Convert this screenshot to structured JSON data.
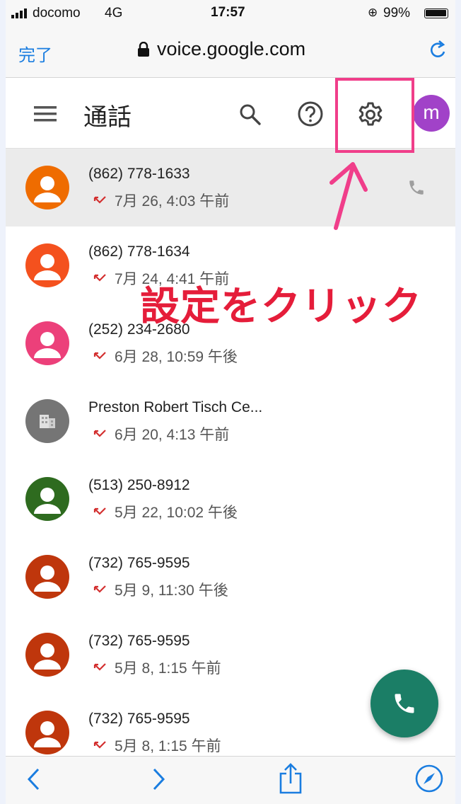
{
  "status_bar": {
    "carrier": "docomo",
    "network": "4G",
    "time": "17:57",
    "battery": "99%"
  },
  "browser": {
    "done_label": "完了",
    "url": "voice.google.com"
  },
  "app_header": {
    "title": "通話",
    "avatar_letter": "m"
  },
  "calls": [
    {
      "name": "(862) 778-1633",
      "time": "7月 26, 4:03 午前",
      "avatar_color": "#ef6c00",
      "avatar_type": "person",
      "selected": true
    },
    {
      "name": "(862) 778-1634",
      "time": "7月 24, 4:41 午前",
      "avatar_color": "#f4511e",
      "avatar_type": "person",
      "selected": false
    },
    {
      "name": "(252) 234-2680",
      "time": "6月 28, 10:59 午後",
      "avatar_color": "#ec407a",
      "avatar_type": "person",
      "selected": false
    },
    {
      "name": "Preston Robert Tisch Ce...",
      "time": "6月 20, 4:13 午前",
      "avatar_color": "#757575",
      "avatar_type": "business",
      "selected": false
    },
    {
      "name": "(513) 250-8912",
      "time": "5月 22, 10:02 午後",
      "avatar_color": "#2e6b1f",
      "avatar_type": "person",
      "selected": false
    },
    {
      "name": "(732) 765-9595",
      "time": "5月 9, 11:30 午後",
      "avatar_color": "#bf360c",
      "avatar_type": "person",
      "selected": false
    },
    {
      "name": "(732) 765-9595",
      "time": "5月 8, 1:15 午前",
      "avatar_color": "#bf360c",
      "avatar_type": "person",
      "selected": false
    },
    {
      "name": "(732) 765-9595",
      "time": "5月 8, 1:15 午前",
      "avatar_color": "#bf360c",
      "avatar_type": "person",
      "selected": false
    }
  ],
  "annotation": {
    "text": "設定をクリック",
    "color": "#e51d3a",
    "box_color": "#f03e8a"
  },
  "colors": {
    "fab": "#1b7e66",
    "link_blue": "#1a7de0",
    "missed_call_red": "#d32f2f"
  }
}
